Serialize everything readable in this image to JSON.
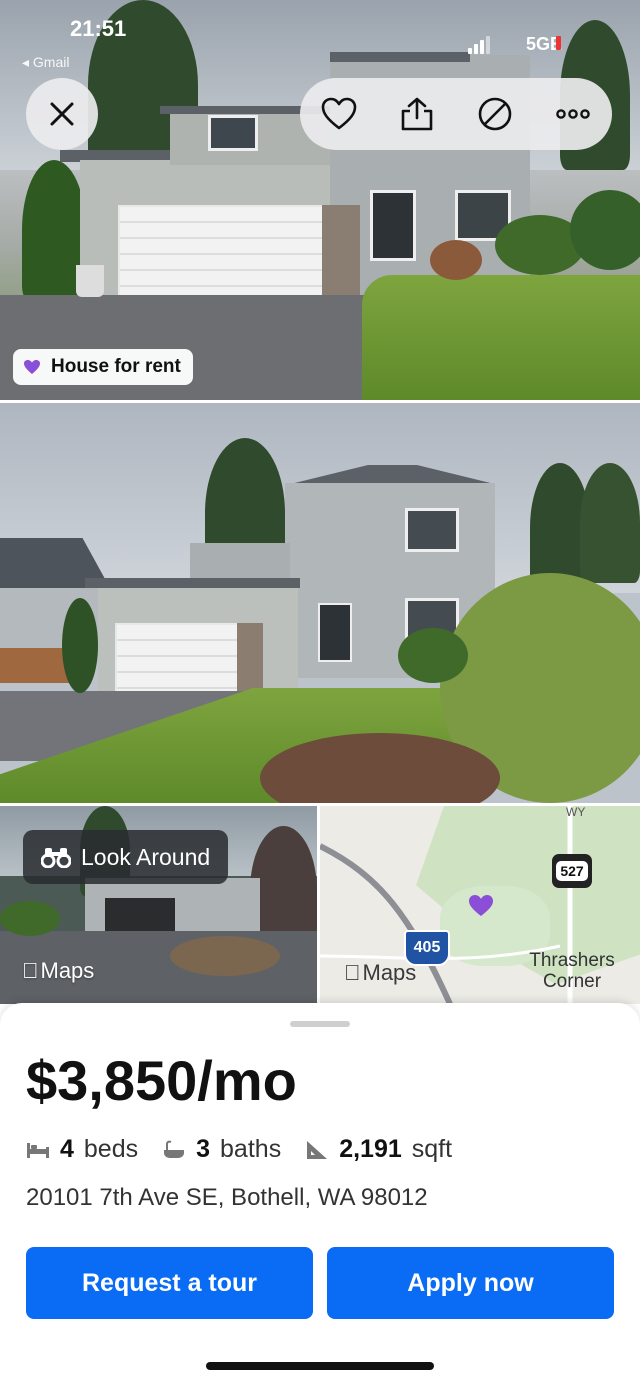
{
  "status_bar": {
    "time": "21:51",
    "back_app": "◂ Gmail",
    "network": "5GE"
  },
  "top_actions": {
    "close_icon": "close-icon",
    "favorite_icon": "heart-icon",
    "share_icon": "share-icon",
    "hide_icon": "hide-icon",
    "more_icon": "more-icon"
  },
  "listing_badge": {
    "label": "House for rent",
    "accent": "#8a4fd6"
  },
  "look_around": {
    "label": "Look Around",
    "provider": "Maps"
  },
  "map": {
    "provider": "Maps",
    "highway_shield": "405",
    "route_shield": "527",
    "place_label_1": "Thrashers",
    "place_label_2": "Corner",
    "road_label": "WY"
  },
  "listing": {
    "price": "$3,850/mo",
    "beds_value": "4",
    "beds_label": "beds",
    "baths_value": "3",
    "baths_label": "baths",
    "sqft_value": "2,191",
    "sqft_label": "sqft",
    "address": "20101 7th Ave SE, Bothell, WA 98012"
  },
  "buttons": {
    "request_tour": "Request a tour",
    "apply_now": "Apply now",
    "primary_color": "#0a6cf5"
  }
}
